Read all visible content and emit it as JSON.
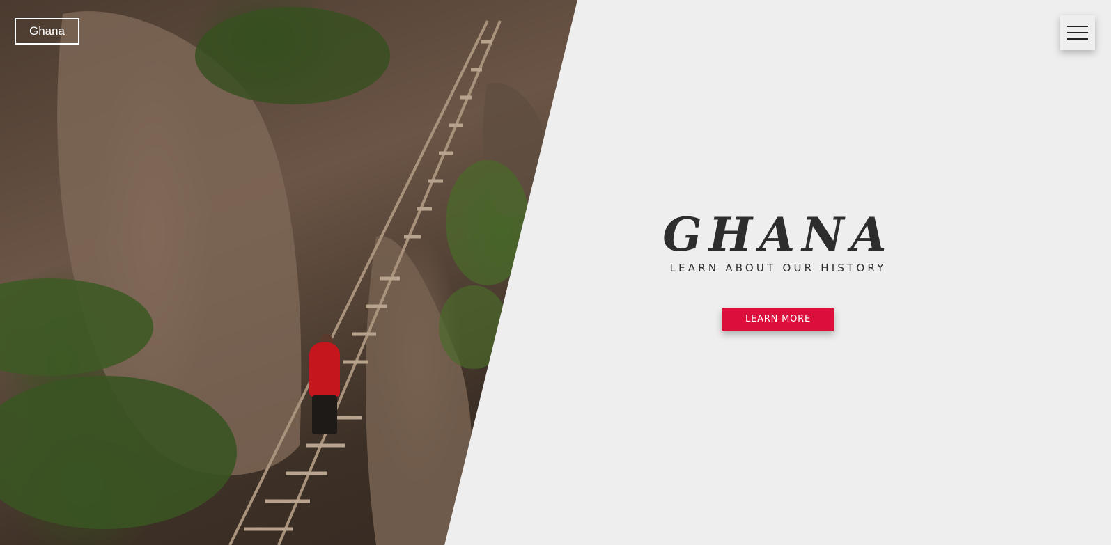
{
  "header": {
    "logo_text": "Ghana",
    "menu_icon": "hamburger-menu-icon"
  },
  "hero": {
    "title": "GHANA",
    "subtitle": "LEARN ABOUT OUR HISTORY",
    "cta_label": "LEARN MORE",
    "image_subject": "hiker in red jacket climbing wooden stairs between rocky cliffs"
  },
  "colors": {
    "background": "#eeeeee",
    "accent": "#dc0f3c",
    "text": "#2d2d2d",
    "logo_border": "#ffffff"
  }
}
